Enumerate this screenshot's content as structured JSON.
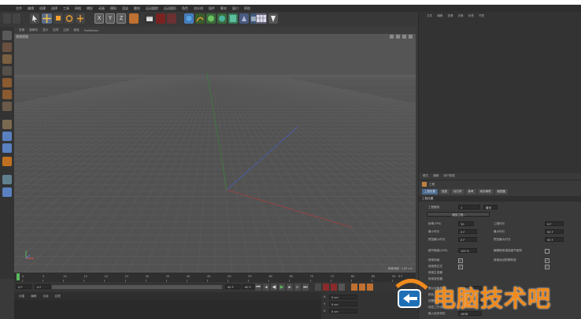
{
  "menu": [
    "文件",
    "编辑",
    "创建",
    "选择",
    "工具",
    "网格",
    "捕捉",
    "动画",
    "模拟",
    "渲染",
    "雕刻",
    "运动跟踪",
    "运动图形",
    "角色",
    "流水线",
    "插件",
    "脚本",
    "窗口",
    "帮助"
  ],
  "viewport": {
    "menu": [
      "查看",
      "摄像机",
      "显示",
      "选项",
      "过滤",
      "面板",
      "ProRender"
    ],
    "label": "透视视图",
    "grid_info": "网格间距 : 100 cm"
  },
  "object_manager": {
    "tabs": [
      "文件",
      "编辑",
      "查看",
      "对象",
      "标签",
      "书签"
    ]
  },
  "attributes": {
    "tabs": [
      "模式",
      "编辑",
      "用户数据"
    ],
    "title": "工程",
    "subtabs": [
      "工程设置",
      "信息",
      "动力学",
      "参考",
      "待办事项",
      "帧插值"
    ],
    "section": "工程设置",
    "fields": {
      "project_scale_label": "工程缩放",
      "project_scale_value": "1",
      "project_scale_unit": "厘米",
      "scale_button": "缩放工程...",
      "fps_label": "帧率(FPS)",
      "fps_value": "30",
      "project_time_label": "工程时长",
      "project_time_value": "0 F",
      "min_time_label": "最小时长",
      "min_time_value": "0 F",
      "max_time_label": "最大时长",
      "max_time_value": "90 F",
      "preview_min_label": "预览最小时长",
      "preview_min_value": "0 F",
      "preview_max_label": "预览最大时长",
      "preview_max_value": "90 F",
      "lod_label": "细节程度(LOD)",
      "lod_value": "100 %",
      "render_lod_label": "编辑使用渲染细节级别",
      "use_anim_label": "使用动画",
      "use_expr_label": "使用表达式",
      "use_gen_label": "使用生成器",
      "use_deform_label": "使用变形器",
      "use_motion_label": "使用运动剪辑系统",
      "default_color_label": "默认对象颜色",
      "default_color_value": "灰蓝色",
      "color_label": "颜色",
      "view_clip_label": "视图修剪",
      "view_clip_value": "中",
      "linear_workflow_label": "线性工作流程",
      "input_color_label": "输入色彩特性",
      "input_color_value": "sRGB"
    }
  },
  "timeline": {
    "ticks": [
      "0",
      "5",
      "10",
      "15",
      "20",
      "25",
      "30",
      "35",
      "40",
      "45",
      "50",
      "55",
      "60",
      "65",
      "70",
      "75",
      "80",
      "85",
      "90"
    ],
    "end_label": "0 F"
  },
  "transport": {
    "start": "0 F",
    "current": "0 F",
    "end": "90 F",
    "end2": "90 F"
  },
  "materials": {
    "tabs": [
      "创建",
      "编辑",
      "功能",
      "纹理"
    ]
  },
  "coords": {
    "rows": [
      "X",
      "Y",
      "Z"
    ],
    "values": [
      "0 cm",
      "0 cm",
      "0 cm"
    ]
  },
  "watermark": {
    "text": "电脑技术吧"
  }
}
